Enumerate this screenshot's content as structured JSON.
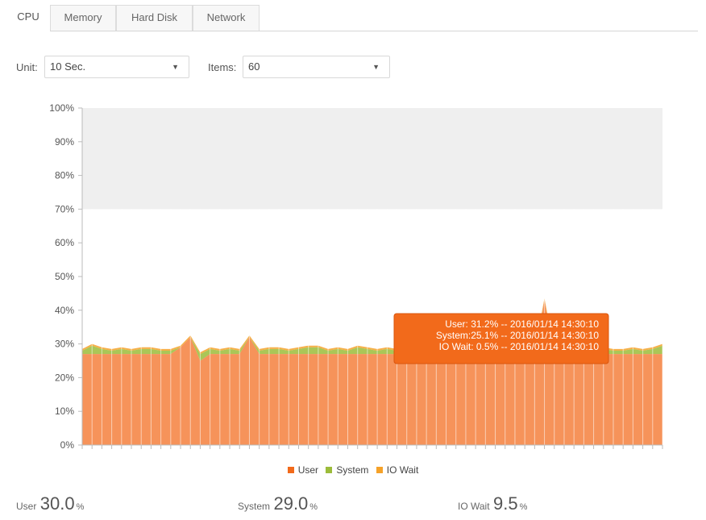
{
  "tabs": [
    {
      "label": "CPU",
      "active": true
    },
    {
      "label": "Memory",
      "active": false
    },
    {
      "label": "Hard Disk",
      "active": false
    },
    {
      "label": "Network",
      "active": false
    }
  ],
  "controls": {
    "unit_label": "Unit:",
    "unit_value": "10 Sec.",
    "items_label": "Items:",
    "items_value": "60"
  },
  "colors": {
    "user": "#f26a1b",
    "system": "#9cbc3a",
    "io_wait": "#f5a229",
    "tooltip_bg": "#f26a1b",
    "plot_band": "#efefef"
  },
  "chart_data": {
    "type": "area",
    "stacked": true,
    "ylim": [
      0,
      100
    ],
    "y_ticks": [
      "0%",
      "10%",
      "20%",
      "30%",
      "40%",
      "50%",
      "60%",
      "70%",
      "80%",
      "90%",
      "100%"
    ],
    "x_points": 60,
    "grid": "vertical",
    "shaded_band": [
      70,
      100
    ],
    "legend_position": "bottom",
    "series": [
      {
        "name": "User",
        "color_key": "user",
        "values": [
          27,
          27,
          27,
          27,
          27,
          27,
          27,
          27,
          27,
          27,
          29,
          32,
          25,
          27,
          27,
          27,
          27,
          32,
          27,
          27,
          27,
          27,
          27,
          27,
          27,
          27,
          27,
          27,
          27,
          27,
          27,
          27,
          27,
          27,
          27,
          27,
          27,
          27,
          27,
          27,
          27,
          27,
          27,
          27,
          27,
          27,
          27,
          43,
          27,
          27,
          27,
          27,
          27,
          27,
          27,
          27,
          27,
          27,
          27,
          27
        ]
      },
      {
        "name": "System",
        "color_key": "system",
        "values": [
          1,
          2.5,
          1.5,
          1,
          1.5,
          1,
          1.5,
          1.5,
          1,
          1,
          0,
          0,
          2,
          1.5,
          1,
          1.5,
          1,
          0,
          1,
          1.5,
          1.5,
          1,
          1.5,
          2,
          2,
          1,
          1.5,
          1,
          2,
          1.5,
          1,
          1.5,
          1,
          1,
          2.5,
          1,
          1.5,
          1,
          2,
          1,
          1,
          1.5,
          1,
          1,
          1.5,
          1,
          1,
          0,
          1,
          1.5,
          1,
          1,
          1,
          1.5,
          1,
          1,
          1.5,
          1,
          1.5,
          2.5
        ]
      },
      {
        "name": "IO Wait",
        "color_key": "io_wait",
        "values": [
          0.5,
          0.5,
          0.5,
          0.5,
          0.5,
          0.5,
          0.5,
          0.5,
          0.5,
          0.5,
          0.5,
          0.5,
          0.5,
          0.5,
          0.5,
          0.5,
          0.5,
          0.5,
          0.5,
          0.5,
          0.5,
          0.5,
          0.5,
          0.5,
          0.5,
          0.5,
          0.5,
          0.5,
          0.5,
          0.5,
          0.5,
          0.5,
          0.5,
          0.5,
          0.5,
          0.5,
          0.5,
          0.5,
          0.5,
          0.5,
          0.5,
          0.5,
          0.5,
          0.5,
          0.5,
          0.5,
          0.5,
          0.5,
          0.5,
          0.5,
          0.5,
          0.5,
          0.5,
          0.5,
          0.5,
          0.5,
          0.5,
          0.5,
          0.5,
          0.5
        ]
      }
    ],
    "tooltip": {
      "point_index": 44,
      "lines": [
        "User:  31.2% -- 2016/01/14 14:30:10",
        "System:25.1% -- 2016/01/14 14:30:10",
        "IO Wait: 0.5% -- 2016/01/14 14:30:10"
      ]
    }
  },
  "stats": [
    {
      "label": "User",
      "value": "30.0",
      "unit": "%"
    },
    {
      "label": "System",
      "value": "29.0",
      "unit": "%"
    },
    {
      "label": "IO Wait",
      "value": "9.5",
      "unit": "%"
    }
  ]
}
